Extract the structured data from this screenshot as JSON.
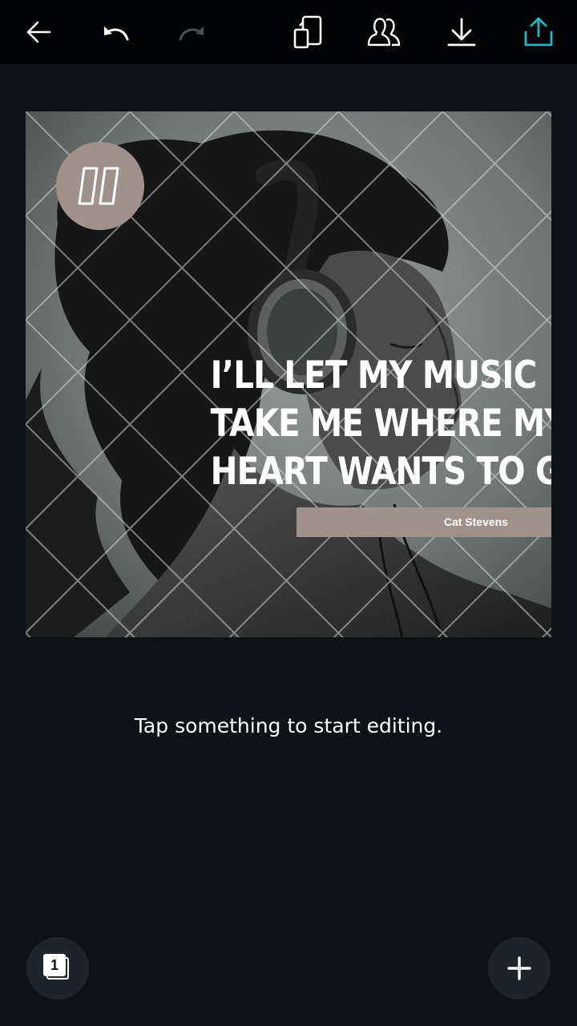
{
  "toolbar": {
    "back_icon": "arrow-left-icon",
    "undo_icon": "undo-icon",
    "redo_icon": "redo-icon",
    "copy_icon": "copy-pages-icon",
    "share_people_icon": "people-icon",
    "download_icon": "download-icon",
    "upload_icon": "share-upload-icon",
    "accent_color": "#1fb8c6",
    "disabled_color": "#4a5058"
  },
  "design": {
    "quote_lines": [
      "I’LL LET MY MUSIC",
      "TAKE ME WHERE MY",
      "HEART WANTS TO GO"
    ],
    "author": "Cat Stevens",
    "quote_mark_icon": "quote-mark-icon",
    "badge_color": "#a0918b",
    "photo_description_icon": "woman-with-headphones-photo"
  },
  "hint": "Tap something to start editing.",
  "bottom": {
    "page_count": "1",
    "pages_icon": "pages-icon",
    "add_icon": "plus-icon"
  }
}
